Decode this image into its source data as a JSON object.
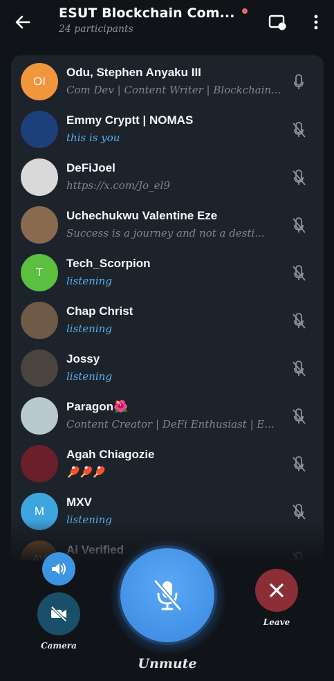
{
  "header": {
    "title": "ESUT Blockchain Com...",
    "subtitle": "24 participants"
  },
  "participants": [
    {
      "name": "Odu, Stephen Anyaku III",
      "status": "Com Dev | Content Writer | Blockchain...",
      "initials": "OI",
      "avatar_color": "#f0963c",
      "status_style": "grey",
      "mic": "active"
    },
    {
      "name": "Emmy Cryptt | NOMAS",
      "status": "this is you",
      "initials": "",
      "avatar_color": "#1d3f7a",
      "status_style": "blue",
      "mic": "muted"
    },
    {
      "name": "DeFiJoel",
      "status": "https://x.com/Jo_el9",
      "initials": "",
      "avatar_color": "#d9d9d9",
      "status_style": "grey",
      "mic": "muted"
    },
    {
      "name": "Uchechukwu Valentine Eze",
      "status": "Success is a journey and not a desti...",
      "initials": "",
      "avatar_color": "#8a6a4e",
      "status_style": "grey",
      "mic": "muted"
    },
    {
      "name": "Tech_Scorpion",
      "status": "listening",
      "initials": "T",
      "avatar_color": "#5bbf3f",
      "status_style": "blue",
      "mic": "muted"
    },
    {
      "name": "Chap Christ",
      "status": "listening",
      "initials": "",
      "avatar_color": "#6f5a48",
      "status_style": "blue",
      "mic": "muted"
    },
    {
      "name": "Jossy",
      "status": "listening",
      "initials": "",
      "avatar_color": "#4a4440",
      "status_style": "blue",
      "mic": "muted"
    },
    {
      "name": "Paragon🌺",
      "status": "Content Creator | DeFi Enthusiast | E...",
      "initials": "",
      "avatar_color": "#b9c9cf",
      "status_style": "grey",
      "mic": "muted"
    },
    {
      "name": "Agah Chiagozie",
      "status": "🏓🏓🏓",
      "initials": "",
      "avatar_color": "#6a1f2a",
      "status_style": "grey",
      "mic": "muted"
    },
    {
      "name": "MXV",
      "status": "listening",
      "initials": "M",
      "avatar_color": "#3ea6df",
      "status_style": "blue",
      "mic": "muted"
    },
    {
      "name": "Ai Verified",
      "status": "",
      "initials": "AV",
      "avatar_color": "#8b5a2b",
      "status_style": "grey",
      "mic": "muted"
    }
  ],
  "controls": {
    "camera_label": "Camera",
    "leave_label": "Leave",
    "unmute_label": "Unmute"
  },
  "colors": {
    "background": "#101419",
    "card": "#1d232b",
    "accent_blue": "#3d95e2",
    "leave_red": "#8b2e36",
    "status_blue": "#5aaff0"
  },
  "icons": {
    "back": "arrow-left-icon",
    "cast": "screen-cast-icon",
    "menu": "more-vert-icon",
    "speaker": "speaker-icon",
    "camera": "camera-off-icon",
    "unmute": "mic-off-icon",
    "leave": "close-icon"
  }
}
